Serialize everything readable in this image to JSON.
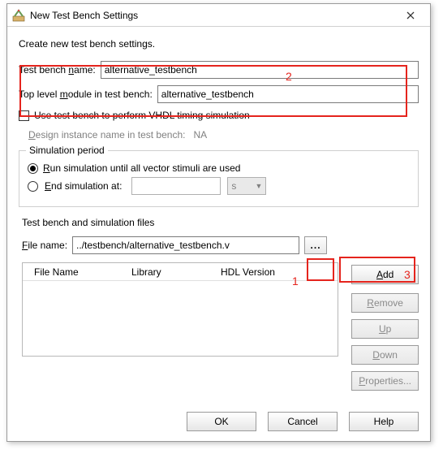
{
  "window": {
    "title": "New Test Bench Settings"
  },
  "description": "Create new test bench settings.",
  "labels": {
    "test_bench_name_pre": "Test bench ",
    "test_bench_name_u": "n",
    "test_bench_name_post": "ame:",
    "top_level_pre": "Top level ",
    "top_level_u": "m",
    "top_level_post": "odule in test bench:",
    "use_tb_vhdl": "Use test bench to perform VHDL timing simulation",
    "design_inst_pre": "",
    "design_inst_u": "D",
    "design_inst_post": "esign instance name in test bench:",
    "design_inst_value": "NA",
    "sim_period": "Simulation period",
    "run_until_pre": "",
    "run_until_u": "R",
    "run_until_post": "un simulation until all vector stimuli are used",
    "end_sim_pre": "",
    "end_sim_u": "E",
    "end_sim_post": "nd simulation at:",
    "time_unit": "s",
    "tb_files_title": "Test bench and simulation files",
    "filename_pre": "",
    "filename_u": "F",
    "filename_post": "ile name:",
    "browse": "..."
  },
  "inputs": {
    "test_bench_name": "alternative_testbench",
    "top_level_module": "alternative_testbench",
    "end_sim_time": "",
    "file_name": "../testbench/alternative_testbench.v"
  },
  "table": {
    "col1": "File Name",
    "col2": "Library",
    "col3": "HDL Version"
  },
  "buttons": {
    "add_u": "A",
    "add_post": "dd",
    "remove_u": "R",
    "remove_post": "emove",
    "up_u": "U",
    "up_post": "p",
    "down_u": "D",
    "down_post": "own",
    "props_u": "P",
    "props_post": "roperties...",
    "ok": "OK",
    "cancel": "Cancel",
    "help": "Help"
  },
  "annotations": {
    "n1": "1",
    "n2": "2",
    "n3": "3"
  }
}
